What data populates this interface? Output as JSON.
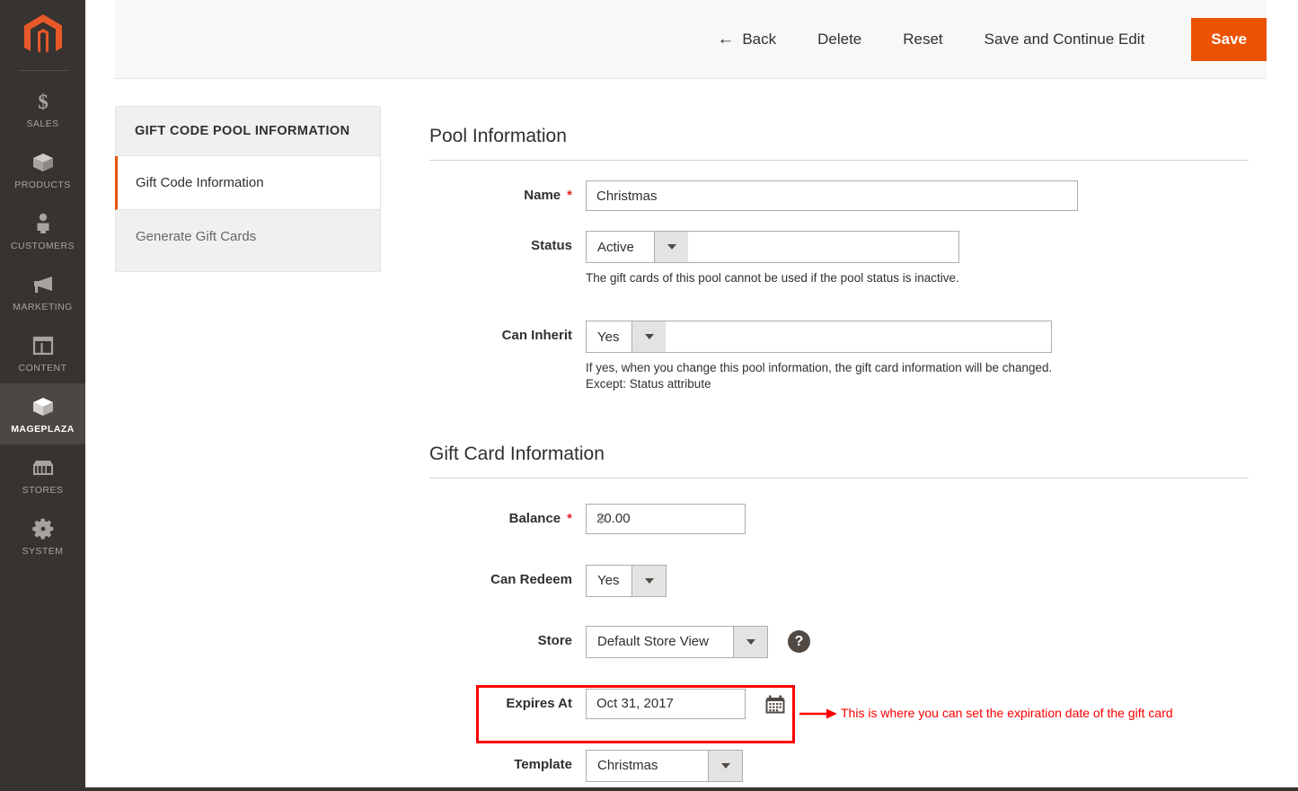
{
  "sidebar": {
    "logo_name": "magento-logo",
    "items": [
      {
        "label": "SALES",
        "icon": "dollar-icon",
        "active": false
      },
      {
        "label": "PRODUCTS",
        "icon": "box-icon",
        "active": false
      },
      {
        "label": "CUSTOMERS",
        "icon": "person-icon",
        "active": false
      },
      {
        "label": "MARKETING",
        "icon": "megaphone-icon",
        "active": false
      },
      {
        "label": "CONTENT",
        "icon": "layout-icon",
        "active": false
      },
      {
        "label": "MAGEPLAZA",
        "icon": "box-icon",
        "active": true
      },
      {
        "label": "STORES",
        "icon": "storefront-icon",
        "active": false
      },
      {
        "label": "SYSTEM",
        "icon": "gear-icon",
        "active": false
      }
    ]
  },
  "header": {
    "back_label": "Back",
    "back_arrow": "←",
    "delete_label": "Delete",
    "reset_label": "Reset",
    "save_continue_label": "Save and Continue Edit",
    "save_label": "Save",
    "save_color": "#eb5202"
  },
  "side_panel": {
    "title": "GIFT CODE POOL INFORMATION",
    "items": [
      {
        "label": "Gift Code Information",
        "active": true
      },
      {
        "label": "Generate Gift Cards",
        "active": false
      }
    ],
    "active_marker_color": "#eb5202"
  },
  "pool_information": {
    "section_title": "Pool Information",
    "name": {
      "label": "Name",
      "required": "*",
      "value": "Christmas"
    },
    "status": {
      "label": "Status",
      "value": "Active",
      "note": "The gift cards of this pool cannot be used if the pool status is inactive."
    },
    "can_inherit": {
      "label": "Can Inherit",
      "value": "Yes",
      "note_line1": "If yes, when you change this pool information, the gift card information will be changed.",
      "note_line2": "Except: Status attribute"
    }
  },
  "gift_card_information": {
    "section_title": "Gift Card Information",
    "balance": {
      "label": "Balance",
      "required": "*",
      "currency": "$",
      "value": "20.00"
    },
    "can_redeem": {
      "label": "Can Redeem",
      "value": "Yes"
    },
    "store": {
      "label": "Store",
      "value": "Default Store View",
      "help_glyph": "?"
    },
    "expires_at": {
      "label": "Expires At",
      "value": "Oct 31, 2017",
      "calendar_icon": "calendar-icon"
    },
    "template": {
      "label": "Template",
      "value": "Christmas"
    }
  },
  "annotation": {
    "text": "This is where you can set the expiration date of the gift card",
    "color": "#fb0000"
  }
}
